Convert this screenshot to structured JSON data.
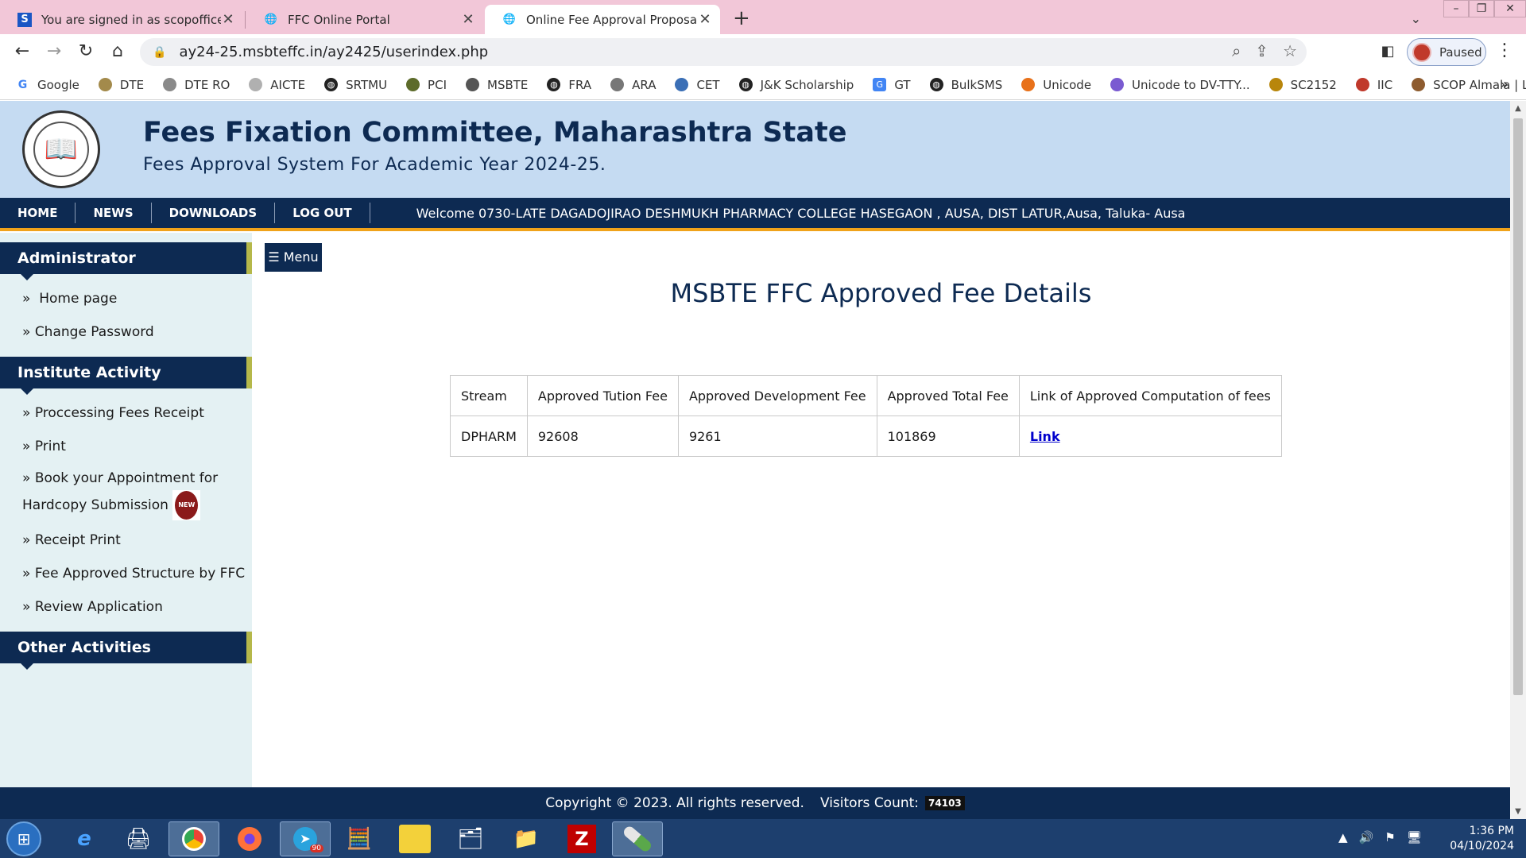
{
  "browser": {
    "tabs": [
      {
        "title": "You are signed in as scopoffice",
        "favicon_letter": "S"
      },
      {
        "title": "FFC Online Portal"
      },
      {
        "title": "Online Fee Approval Proposal Po"
      }
    ],
    "address_url": "ay24-25.msbteffc.in/ay2425/userindex.php",
    "profile_label": "Paused",
    "bookmarks": [
      "Google",
      "DTE",
      "DTE RO",
      "AICTE",
      "SRTMU",
      "PCI",
      "MSBTE",
      "FRA",
      "ARA",
      "CET",
      "J&K Scholarship",
      "GT",
      "BulkSMS",
      "Unicode",
      "Unicode to DV-TTY...",
      "SC2152",
      "IIC",
      "SCOP Almala | Login"
    ],
    "bookmark_more": "»",
    "colors": {
      "tabbar": "#f2c7d8",
      "omnibox": "#eff0f3"
    }
  },
  "site": {
    "title": "Fees Fixation Committee, Maharashtra State",
    "subtitle": "Fees Approval System For Academic Year 2024-25.",
    "nav": [
      "HOME",
      "NEWS",
      "DOWNLOADS",
      "LOG OUT"
    ],
    "welcome": "Welcome 0730-LATE DAGADOJIRAO DESHMUKH PHARMACY COLLEGE HASEGAON , AUSA, DIST LATUR,Ausa,  Taluka- Ausa",
    "colors": {
      "primary": "#0d2a52",
      "header_bg": "#c5dbf2",
      "accent": "#f0a21a",
      "sidebar_bg": "#e4f1f3"
    }
  },
  "sidebar": {
    "sections": [
      {
        "heading": "Administrator",
        "items": [
          "Home page",
          "Change Password"
        ]
      },
      {
        "heading": "Institute Activity",
        "items": [
          "Proccessing Fees Receipt",
          "Print",
          "Book your Appointment for Hardcopy Submission",
          "Receipt Print",
          "Fee Approved Structure by FFC",
          "Review Application"
        ]
      },
      {
        "heading": "Other Activities",
        "items": []
      }
    ],
    "new_badge": "NEW",
    "bullet": "»"
  },
  "main": {
    "menu_button": "☰ Menu",
    "heading": "MSBTE FFC Approved Fee Details",
    "table": {
      "headers": [
        "Stream",
        "Approved Tution Fee",
        "Approved Development Fee",
        "Approved Total Fee",
        "Link of Approved Computation of fees"
      ],
      "rows": [
        [
          "DPHARM",
          "92608",
          "9261",
          "101869",
          "Link"
        ]
      ]
    }
  },
  "footer": {
    "copyright": "Copyright © 2023. All rights reserved.",
    "visitors_label": "Visitors Count:",
    "visitors_count": "74103"
  },
  "taskbar": {
    "telegram_badge": "90",
    "time": "1:36 PM",
    "date": "04/10/2024"
  }
}
